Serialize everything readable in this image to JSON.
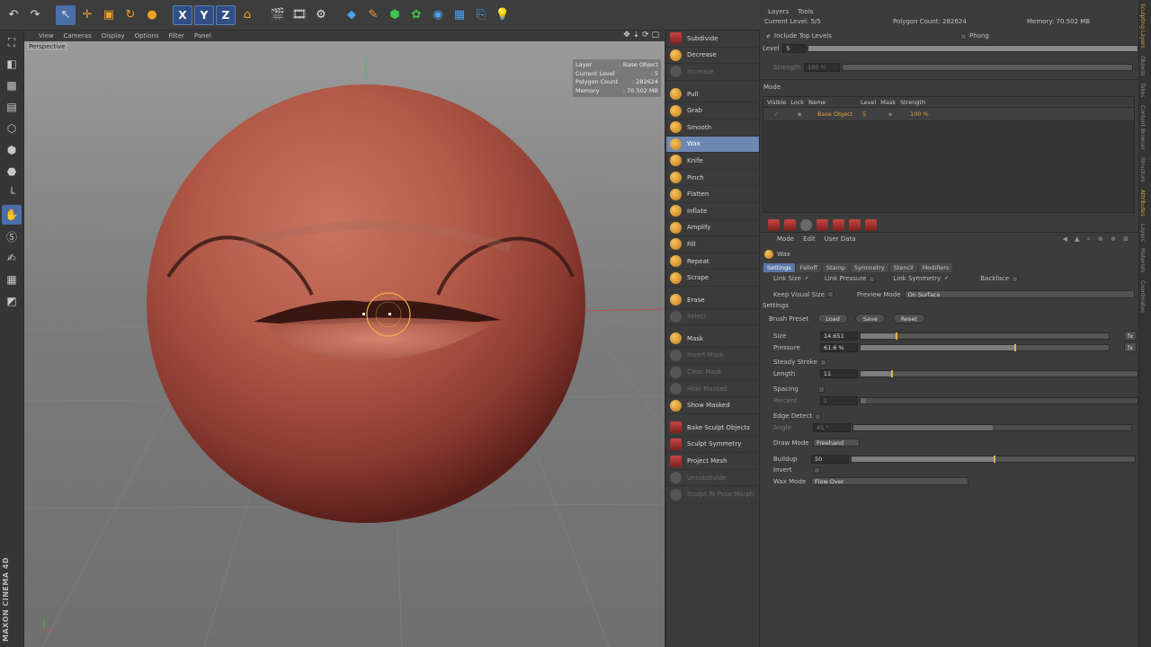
{
  "viewport": {
    "menu": [
      "View",
      "Cameras",
      "Display",
      "Options",
      "Filter",
      "Panel"
    ],
    "camera_label": "Perspective",
    "hud": [
      {
        "k": "Layer",
        "v": ": Base Object"
      },
      {
        "k": "Current Level",
        "v": ": 5"
      },
      {
        "k": "Polygon Count",
        "v": ": 282624"
      },
      {
        "k": "Memory",
        "v": ": 70.502 MB"
      }
    ],
    "logo": "MAXON CINEMA 4D"
  },
  "toolbar": {
    "axis_x": "X",
    "axis_y": "Y",
    "axis_z": "Z"
  },
  "palette": {
    "groups": [
      [
        {
          "label": "Subdivide",
          "icon": "red"
        },
        {
          "label": "Decrease",
          "icon": "orange"
        },
        {
          "label": "Increase",
          "icon": "gray",
          "disabled": true
        }
      ],
      [
        {
          "label": "Pull"
        },
        {
          "label": "Grab"
        },
        {
          "label": "Smooth"
        },
        {
          "label": "Wax",
          "selected": true
        },
        {
          "label": "Knife"
        },
        {
          "label": "Pinch"
        },
        {
          "label": "Flatten"
        },
        {
          "label": "Inflate"
        },
        {
          "label": "Amplify"
        },
        {
          "label": "Fill"
        },
        {
          "label": "Repeat"
        },
        {
          "label": "Scrape"
        }
      ],
      [
        {
          "label": "Erase"
        },
        {
          "label": "Select",
          "disabled": true
        }
      ],
      [
        {
          "label": "Mask"
        },
        {
          "label": "Invert Mask",
          "disabled": true
        },
        {
          "label": "Clear Mask",
          "disabled": true
        },
        {
          "label": "Hide Masked",
          "disabled": true
        },
        {
          "label": "Show Masked"
        }
      ],
      [
        {
          "label": "Bake Sculpt Objects",
          "icon": "red"
        },
        {
          "label": "Sculpt Symmetry",
          "icon": "red"
        },
        {
          "label": "Project Mesh",
          "icon": "red"
        },
        {
          "label": "Unsubdivide",
          "disabled": true
        },
        {
          "label": "Sculpt To Pose Morph",
          "disabled": true
        }
      ]
    ]
  },
  "layers_panel": {
    "menu": [
      "Layers",
      "Tools"
    ],
    "current_level_label": "Current Level: 5/5",
    "polygon_count_label": "Polygon Count: 282624",
    "memory_label": "Memory: 70.502 MB",
    "include_top_levels": "Include Top Levels",
    "phong": "Phong",
    "level_label": "Level",
    "level_value": "5",
    "strength_label": "Strength",
    "strength_value": "100 %",
    "mode_label": "Mode",
    "columns": [
      "Visible",
      "Lock",
      "Name",
      "Level",
      "Mask",
      "Strength"
    ],
    "rows": [
      {
        "name": "Base Object",
        "level": "5",
        "strength": "100 %"
      }
    ]
  },
  "attributes": {
    "menu": [
      "Mode",
      "Edit",
      "User Data"
    ],
    "tool_name": "Wax",
    "tabs": [
      "Settings",
      "Falloff",
      "Stamp",
      "Symmetry",
      "Stencil",
      "Modifiers"
    ],
    "link_size": "Link Size",
    "link_pressure": "Link Pressure",
    "link_symmetry": "Link Symmetry",
    "backface": "Backface",
    "keep_visual_size": "Keep Visual Size",
    "preview_mode_label": "Preview Mode",
    "preview_mode_value": "On Surface",
    "settings_head": "Settings",
    "brush_preset": "Brush Preset",
    "load": "Load",
    "save": "Save",
    "reset": "Reset",
    "size_label": "Size",
    "size_value": "14.651",
    "pressure_label": "Pressure",
    "pressure_value": "61.6 %",
    "fx": "fx",
    "steady_stroke": "Steady Stroke",
    "length_label": "Length",
    "length_value": "11",
    "spacing": "Spacing",
    "percent_label": "Percent",
    "percent_value": "2",
    "edge_detect": "Edge Detect",
    "angle_label": "Angle",
    "angle_value": "45 °",
    "draw_mode_label": "Draw Mode",
    "draw_mode_value": "Freehand",
    "buildup_label": "Buildup",
    "buildup_value": "50",
    "invert": "Invert",
    "wax_mode_label": "Wax Mode",
    "wax_mode_value": "Flow Over"
  },
  "right_tabs": [
    "Sculpting Layers",
    "Objects",
    "Takes",
    "Content Browser",
    "Structure",
    "Attributes",
    "Layers",
    "Materials",
    "Coordinates"
  ]
}
